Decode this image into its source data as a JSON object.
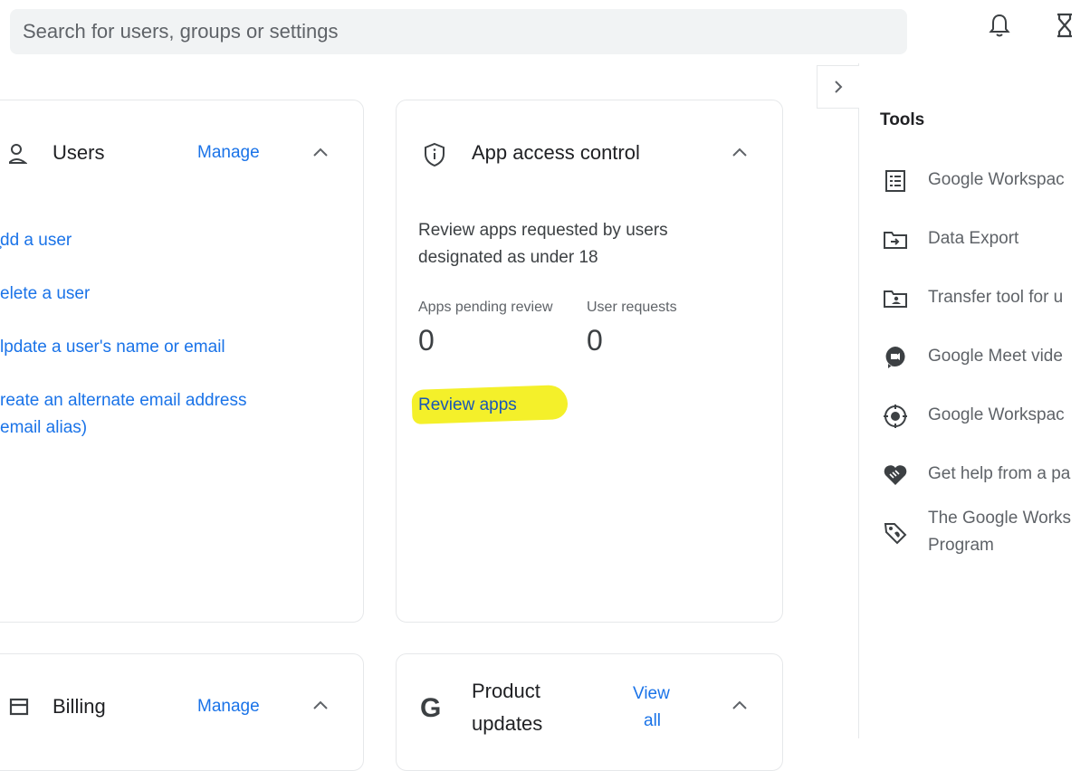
{
  "search": {
    "placeholder": "Search for users, groups or settings"
  },
  "users_card": {
    "title": "Users",
    "manage": "Manage",
    "links": [
      "̧dd a user",
      "elete a user",
      "lpdate a user's name or email",
      "reate an alternate email address",
      "email alias)"
    ]
  },
  "app_access_card": {
    "title": "App access control",
    "description_line1": "Review apps requested by users",
    "description_line2": "designated as under 18",
    "stats": [
      {
        "label": "Apps pending review",
        "value": "0"
      },
      {
        "label": "User requests",
        "value": "0"
      }
    ],
    "review_link": "Review apps"
  },
  "billing_card": {
    "title": "Billing",
    "manage": "Manage"
  },
  "product_updates_card": {
    "title_line1": "Product",
    "title_line2": "updates",
    "view_line1": "View",
    "view_line2": "all"
  },
  "tools": {
    "title": "Tools",
    "items": [
      {
        "label": "Google Workspac",
        "icon": "document-list-icon"
      },
      {
        "label": "Data Export",
        "icon": "folder-export-icon"
      },
      {
        "label": "Transfer tool for u",
        "icon": "folder-user-icon"
      },
      {
        "label": "Google Meet vide",
        "icon": "meet-camera-icon"
      },
      {
        "label": "Google Workspac",
        "icon": "target-icon"
      },
      {
        "label": "Get help from a pa",
        "icon": "handshake-icon"
      },
      {
        "label": "The Google Works",
        "label2": "Program",
        "icon": "tag-icon"
      }
    ]
  },
  "colors": {
    "link": "#1a73e8",
    "highlight": "#f4f02a"
  }
}
